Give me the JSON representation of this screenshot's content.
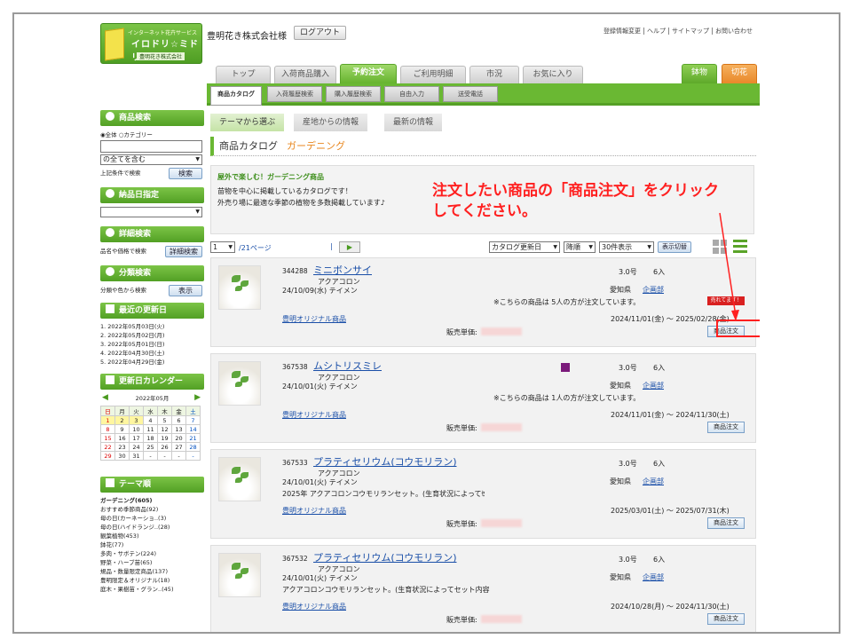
{
  "header": {
    "logo": {
      "top": "インターネット花卉サービス",
      "main": "イロドリ☆ミドリ",
      "sub": "豊明花き株式会社"
    },
    "company": "豊明花き株式会社様",
    "logout": "ログアウト",
    "top_links": [
      "登録情報変更",
      "ヘルプ",
      "サイトマップ",
      "お問い合わせ"
    ],
    "tabs": [
      "トップ",
      "入荷商品購入",
      "予約注文",
      "ご利用明細",
      "市況",
      "お気に入り"
    ],
    "right_tabs": [
      "鉢物",
      "切花"
    ],
    "subtabs": [
      "商品カタログ",
      "入荷履歴検索",
      "購入履歴検索",
      "自由入力",
      "送受電話"
    ]
  },
  "sidebar": {
    "search": {
      "title": "商品検索",
      "radio_all": "全体",
      "radio_cat": "カテゴリー",
      "select": "の全てを含む",
      "note": "上記条件で検索",
      "button": "検索"
    },
    "date": {
      "title": "納品日指定"
    },
    "detail": {
      "title": "詳細検索",
      "note": "品名や価格で検索",
      "button": "詳細検索"
    },
    "category": {
      "title": "分類検索",
      "note": "分類や色から検索",
      "button": "表示"
    },
    "updates": {
      "title": "最近の更新日",
      "items": [
        "1. 2022年05月03日(火)",
        "2. 2022年05月02日(月)",
        "3. 2022年05月01日(日)",
        "4. 2022年04月30日(土)",
        "5. 2022年04月29日(金)"
      ]
    },
    "calendar": {
      "title": "更新日カレンダー",
      "month": "2022年05月",
      "prev": "◀",
      "next": "▶",
      "weekdays": [
        "日",
        "月",
        "火",
        "水",
        "木",
        "金",
        "土"
      ],
      "rows": [
        [
          "1",
          "2",
          "3",
          "4",
          "5",
          "6",
          "7"
        ],
        [
          "8",
          "9",
          "10",
          "11",
          "12",
          "13",
          "14"
        ],
        [
          "15",
          "16",
          "17",
          "18",
          "19",
          "20",
          "21"
        ],
        [
          "22",
          "23",
          "24",
          "25",
          "26",
          "27",
          "28"
        ],
        [
          "29",
          "30",
          "31",
          "-",
          "-",
          "-",
          "-"
        ]
      ]
    },
    "themes": {
      "title": "テーマ順",
      "items": [
        "ガーデニング(605)",
        "おすすめ季節商品(92)",
        "母の日(カーネーショ..(3)",
        "母の日(ハイドランジ..(28)",
        "観葉植物(453)",
        "鉢花(77)",
        "多肉・サボテン(224)",
        "野菜・ハーブ苗(65)",
        "規品・数量限定商品(137)",
        "豊明限定＆オリジナル(18)",
        "庭木・果樹苗・グラン..(45)"
      ]
    }
  },
  "content": {
    "tabs": [
      "テーマから選ぶ",
      "産地からの情報",
      "最新の情報"
    ],
    "title": "商品カタログ",
    "title_sub": "ガーデニング",
    "desc_head": "屋外で楽しむ！ガーデニング商品",
    "desc_lines": [
      "苗物を中心に掲載しているカタログです！",
      "外売り場に最適な季節の植物を多数掲載しています♪"
    ],
    "annotation": [
      "注文したい商品の「商品注文」をクリック",
      "してください。"
    ],
    "pager": {
      "page": "1",
      "pages": "/21ページ",
      "sep": "|",
      "play": "▶",
      "sort": "カタログ更新日",
      "order": "降順",
      "count": "30件表示",
      "switch": "表示切替"
    }
  },
  "items": [
    {
      "code": "344288",
      "name": "ミニボンサイ",
      "maker": "アクアコロン",
      "date": "24/10/09(水) テイメン",
      "size": "3.0号",
      "qty": "6入",
      "note": "※こちらの商品は 5人の方が注文しています。",
      "origin": "愛知県",
      "plan": "企画部",
      "sold": "売れてます！",
      "series": "豊明オリジナル商品",
      "period": "2024/11/01(金) 〜 2025/02/28(金)",
      "price_label": "販売単価:",
      "button": "商品注文"
    },
    {
      "code": "367538",
      "name": "ムシトリスミレ",
      "maker": "アクアコロン",
      "date": "24/10/01(火) テイメン",
      "size": "3.0号",
      "qty": "6入",
      "note": "※こちらの商品は 1人の方が注文しています。",
      "origin": "愛知県",
      "plan": "企画部",
      "sold": "",
      "series": "豊明オリジナル商品",
      "period": "2024/11/01(金) 〜 2024/11/30(土)",
      "price_label": "販売単価:",
      "button": "商品注文"
    },
    {
      "code": "367533",
      "name": "プラティセリウム(コウモリラン)",
      "maker": "アクアコロン",
      "date": "24/10/01(火) テイメン",
      "size": "3.0号",
      "qty": "6入",
      "note": "2025年 アクアコロンコウモリランセット。(生育状況によってｾ",
      "origin": "愛知県",
      "plan": "企画部",
      "sold": "",
      "series": "豊明オリジナル商品",
      "period": "2025/03/01(土) 〜 2025/07/31(木)",
      "price_label": "販売単価:",
      "button": "商品注文"
    },
    {
      "code": "367532",
      "name": "プラティセリウム(コウモリラン)",
      "maker": "アクアコロン",
      "date": "24/10/01(火) テイメン",
      "size": "3.0号",
      "qty": "6入",
      "note": "アクアコロンコウモリランセット。(生育状況によってセット内容",
      "origin": "愛知県",
      "plan": "企画部",
      "sold": "",
      "series": "豊明オリジナル商品",
      "period": "2024/10/28(月) 〜 2024/11/30(土)",
      "price_label": "販売単価:",
      "button": "商品注文"
    }
  ],
  "colors": {
    "green": "#6ab833",
    "orange": "#e8871f",
    "red": "#ff2020",
    "link": "#1a4fa8"
  }
}
